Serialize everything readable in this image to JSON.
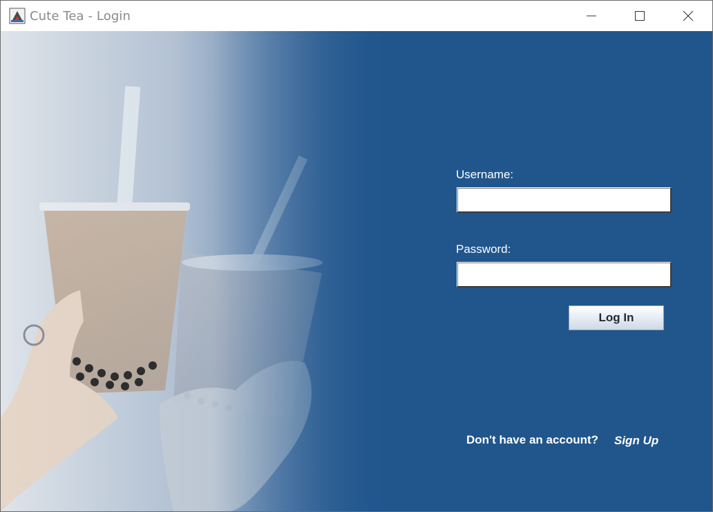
{
  "window": {
    "title": "Cute Tea - Login",
    "icon": "java-app-icon"
  },
  "caption_buttons": {
    "minimize": "minimize-icon",
    "maximize": "maximize-icon",
    "close": "close-icon"
  },
  "login_form": {
    "username_label": "Username:",
    "username_value": "",
    "password_label": "Password:",
    "password_value": "",
    "login_button": "Log In",
    "signup_prompt": "Don't have an account?",
    "signup_link": "Sign Up"
  },
  "colors": {
    "panel_background": "#21568d",
    "title_text": "#8a8a8a",
    "form_text": "#ffffff"
  },
  "image": {
    "subject": "two hands holding bubble tea cups"
  }
}
